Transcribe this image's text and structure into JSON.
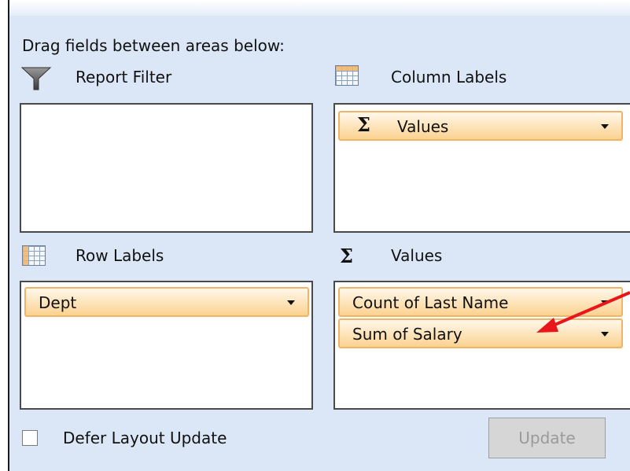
{
  "instruction": "Drag fields between areas below:",
  "areas": {
    "report_filter": {
      "title": "Report Filter",
      "icon": "filter-icon"
    },
    "column_labels": {
      "title": "Column Labels",
      "icon": "column-grid-icon",
      "fields": [
        {
          "label": "Values",
          "icon": "sigma-icon"
        }
      ]
    },
    "row_labels": {
      "title": "Row Labels",
      "icon": "row-grid-icon",
      "fields": [
        {
          "label": "Dept"
        }
      ]
    },
    "values": {
      "title": "Values",
      "icon": "sigma-icon",
      "fields": [
        {
          "label": "Count of Last Name"
        },
        {
          "label": "Sum of Salary"
        }
      ]
    }
  },
  "defer_layout_update": {
    "label": "Defer Layout Update",
    "checked": false
  },
  "update_button": {
    "label": "Update",
    "enabled": false
  },
  "colors": {
    "panel": "#dbe7f6",
    "field_fill": "#fde3b8",
    "field_border": "#f0b466",
    "annotation_arrow": "#e8161b"
  }
}
